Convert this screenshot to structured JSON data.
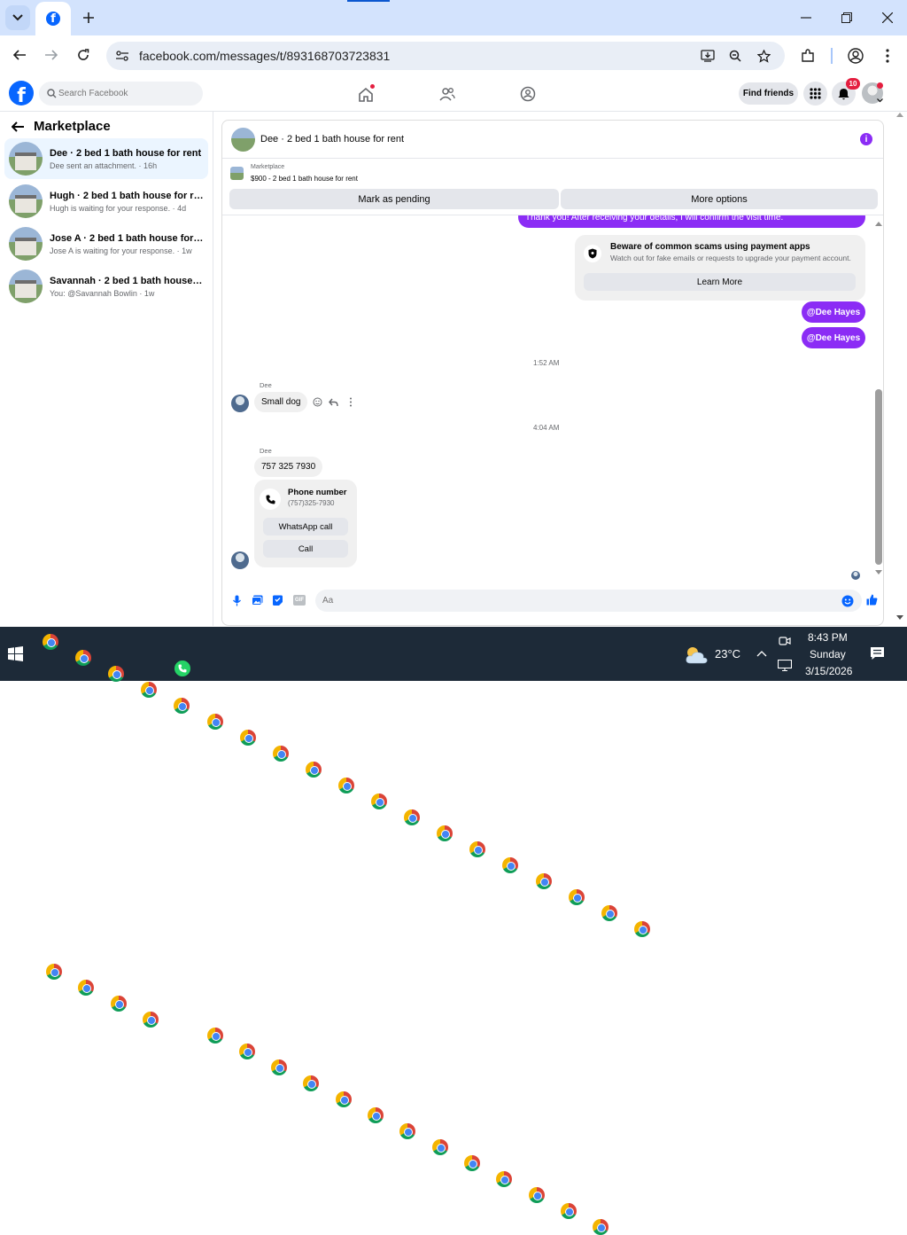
{
  "browser": {
    "tab_icon": "facebook-icon",
    "url": "facebook.com/messages/t/893168703723831"
  },
  "fb": {
    "search_placeholder": "Search Facebook",
    "find_friends": "Find friends",
    "notif_count": "10",
    "brand_color": "#0866ff"
  },
  "sidebar": {
    "title": "Marketplace",
    "items": [
      {
        "title": "Dee · 2 bed 1 bath house for rent",
        "sub": "Dee sent an attachment. · 16h"
      },
      {
        "title": "Hugh · 2 bed 1 bath house for rent",
        "sub": "Hugh is waiting for your response. · 4d"
      },
      {
        "title": "Jose A · 2 bed 1 bath house for rent",
        "sub": "Jose A is waiting for your response. · 1w"
      },
      {
        "title": "Savannah · 2 bed 1 bath house for ...",
        "sub": "You: @Savannah Bowlin · 1w"
      }
    ]
  },
  "chat": {
    "title": "Dee · 2 bed 1 bath house for rent",
    "listing_label": "Marketplace",
    "listing_price": "$900 - 2 bed 1 bath house for rent",
    "mark_pending": "Mark as pending",
    "more_options": "More options",
    "cut_message": "Thank you! After receiving your details, I will confirm the visit time.",
    "warning_title": "Beware of common scams using payment apps",
    "warning_body": "Watch out for fake emails or requests to upgrade your payment account.",
    "learn_more": "Learn More",
    "mention1": "@Dee Hayes",
    "mention2": "@Dee Hayes",
    "time1": "1:52 AM",
    "sender1": "Dee",
    "msg_small_dog": "Small dog",
    "time2": "4:04 AM",
    "sender2": "Dee",
    "msg_phone": "757 325 7930",
    "phone_card_title": "Phone number",
    "phone_card_number": "(757)325-7930",
    "whatsapp_call": "WhatsApp call",
    "call": "Call",
    "composer_placeholder": "Aa",
    "accent_color": "#8b2cf5"
  },
  "taskbar": {
    "temperature": "23°C",
    "time": "8:43 PM",
    "day": "Sunday",
    "date": "3/15/2026"
  }
}
